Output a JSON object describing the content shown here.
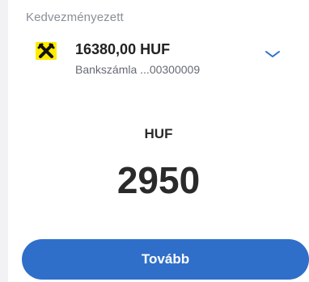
{
  "payee": {
    "section_label": "Kedvezményezett",
    "logo_icon": "raiffeisen-cross-icon",
    "logo_color": "#ffeb00",
    "amount": "16380,00 HUF",
    "account_name": "Bankszámla ...00300009",
    "expand_icon": "chevron-down-icon"
  },
  "transfer": {
    "currency": "HUF",
    "amount": "2950"
  },
  "actions": {
    "next_label": "Tovább",
    "accent_color": "#2f6fc9"
  }
}
